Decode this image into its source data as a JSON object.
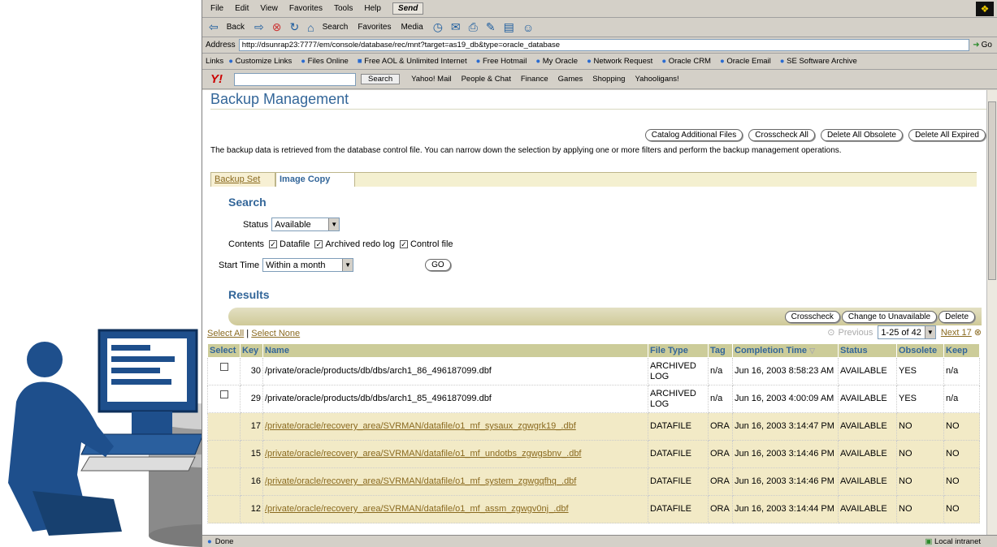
{
  "browser": {
    "menu": [
      "File",
      "Edit",
      "View",
      "Favorites",
      "Tools",
      "Help"
    ],
    "send_label": "Send",
    "toolbar": {
      "back": "Back",
      "search": "Search",
      "favorites": "Favorites",
      "media": "Media"
    },
    "address_label": "Address",
    "address_url": "http://dsunrap23:7777/em/console/database/rec/mnt?target=as19_db&type=oracle_database",
    "go_label": "Go",
    "links_label": "Links",
    "links": [
      "Customize Links",
      "Files Online",
      "Free AOL & Unlimited Internet",
      "Free Hotmail",
      "My Oracle",
      "Network Request",
      "Oracle CRM",
      "Oracle Email",
      "SE Software Archive"
    ],
    "yahoo": {
      "search_button": "Search",
      "items": [
        "Yahoo! Mail",
        "People & Chat",
        "Finance",
        "Games",
        "Shopping",
        "Yahooligans!"
      ]
    },
    "status_text": "Done",
    "zone": "Local intranet"
  },
  "page": {
    "title": "Backup Management",
    "top_buttons": [
      "Catalog Additional Files",
      "Crosscheck All",
      "Delete All Obsolete",
      "Delete All Expired"
    ],
    "description": "The backup data is retrieved from the database control file. You can narrow down the selection by applying one or more filters and perform the backup management operations.",
    "tabs": [
      "Backup Set",
      "Image Copy"
    ],
    "search": {
      "heading": "Search",
      "status_label": "Status",
      "status_value": "Available",
      "contents_label": "Contents",
      "contents": [
        "Datafile",
        "Archived redo log",
        "Control file"
      ],
      "start_time_label": "Start Time",
      "start_time_value": "Within a month",
      "go": "GO"
    },
    "results": {
      "heading": "Results",
      "buttons": [
        "Crosscheck",
        "Change to Unavailable",
        "Delete"
      ],
      "select_all": "Select All",
      "select_none": "Select None",
      "previous": "Previous",
      "range": "1-25 of 42",
      "next": "Next 17",
      "columns": [
        "Select",
        "Key",
        "Name",
        "File Type",
        "Tag",
        "Completion Time",
        "Status",
        "Obsolete",
        "Keep"
      ],
      "rows": [
        {
          "key": "30",
          "name": "/private/oracle/products/db/dbs/arch1_86_496187099.dbf",
          "type": "ARCHIVED LOG",
          "tag": "n/a",
          "time": "Jun 16, 2003 8:58:23 AM",
          "status": "AVAILABLE",
          "obsolete": "YES",
          "keep": "n/a"
        },
        {
          "key": "29",
          "name": "/private/oracle/products/db/dbs/arch1_85_496187099.dbf",
          "type": "ARCHIVED LOG",
          "tag": "n/a",
          "time": "Jun 16, 2003 4:00:09 AM",
          "status": "AVAILABLE",
          "obsolete": "YES",
          "keep": "n/a"
        },
        {
          "key": "17",
          "name": "/private/oracle/recovery_area/SVRMAN/datafile/o1_mf_sysaux_zgwgrk19_.dbf",
          "type": "DATAFILE",
          "tag": "ORA",
          "time": "Jun 16, 2003 3:14:47 PM",
          "status": "AVAILABLE",
          "obsolete": "NO",
          "keep": "NO"
        },
        {
          "key": "15",
          "name": "/private/oracle/recovery_area/SVRMAN/datafile/o1_mf_undotbs_zgwgsbnv_.dbf",
          "type": "DATAFILE",
          "tag": "ORA",
          "time": "Jun 16, 2003 3:14:46 PM",
          "status": "AVAILABLE",
          "obsolete": "NO",
          "keep": "NO"
        },
        {
          "key": "16",
          "name": "/private/oracle/recovery_area/SVRMAN/datafile/o1_mf_system_zgwgqfhq_.dbf",
          "type": "DATAFILE",
          "tag": "ORA",
          "time": "Jun 16, 2003 3:14:46 PM",
          "status": "AVAILABLE",
          "obsolete": "NO",
          "keep": "NO"
        },
        {
          "key": "12",
          "name": "/private/oracle/recovery_area/SVRMAN/datafile/o1_mf_assm_zgwgv0nj_.dbf",
          "type": "DATAFILE",
          "tag": "ORA",
          "time": "Jun 16, 2003 3:14:44 PM",
          "status": "AVAILABLE",
          "obsolete": "NO",
          "keep": "NO"
        }
      ]
    }
  },
  "colors": {
    "oracle_blue": "#336699",
    "table_header": "#cccc99",
    "row_highlight": "#f2eac6"
  }
}
